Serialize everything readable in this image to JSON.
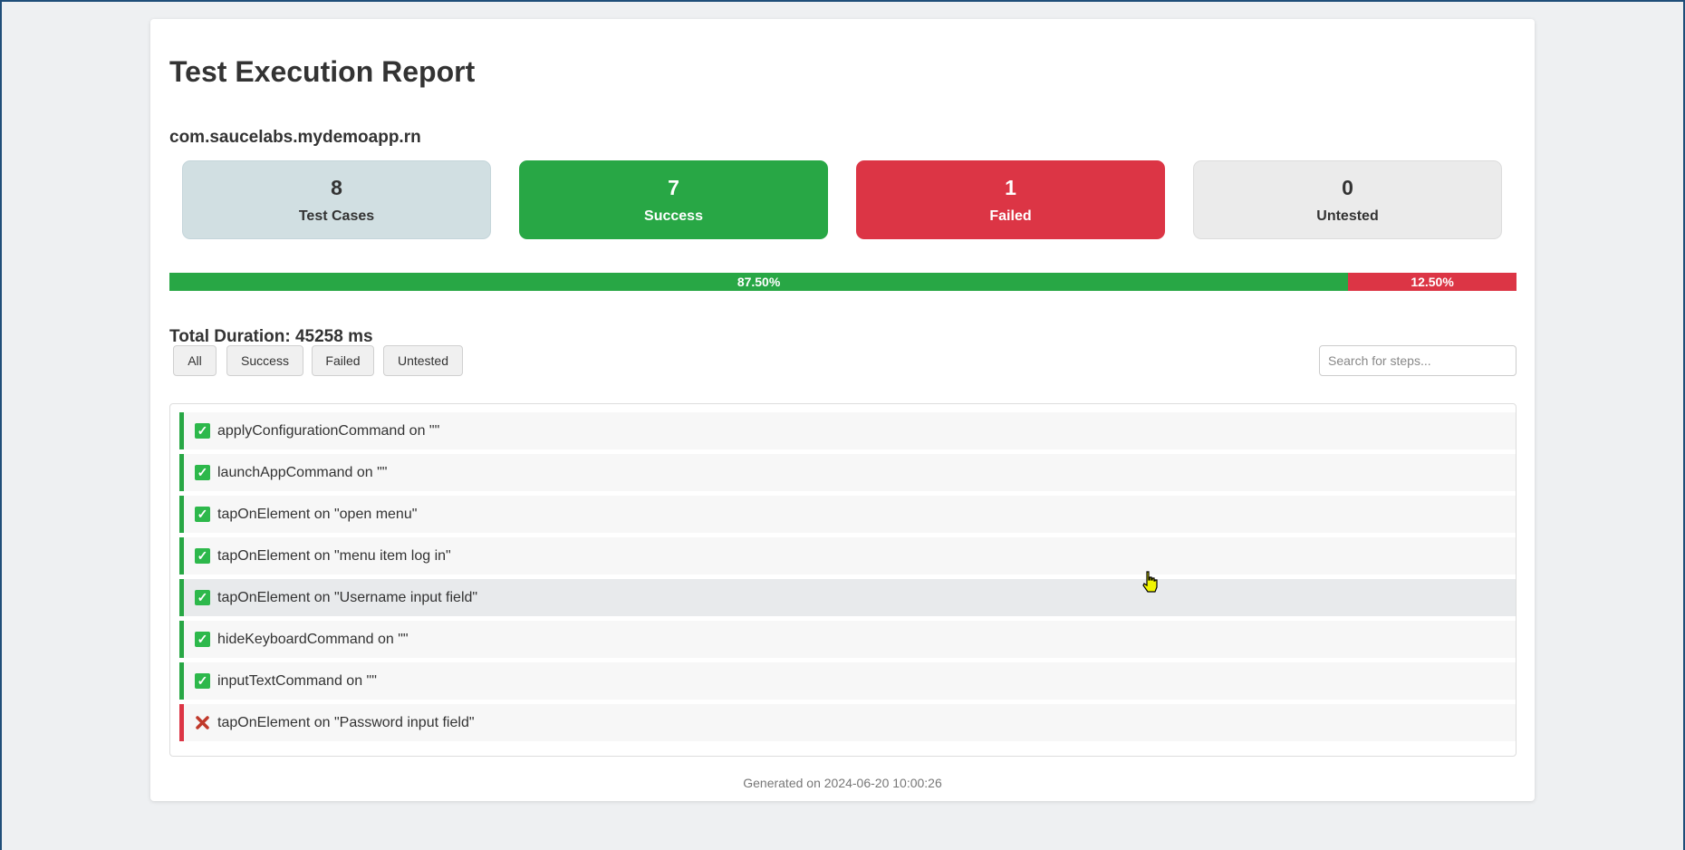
{
  "report": {
    "title": "Test Execution Report",
    "package": "com.saucelabs.mydemoapp.rn"
  },
  "stats": {
    "total": {
      "value": "8",
      "label": "Test Cases"
    },
    "success": {
      "value": "7",
      "label": "Success"
    },
    "failed": {
      "value": "1",
      "label": "Failed"
    },
    "untested": {
      "value": "0",
      "label": "Untested"
    }
  },
  "progress": {
    "success_label": "87.50%",
    "failed_label": "12.50%",
    "success_fraction": 0.875,
    "failed_fraction": 0.125
  },
  "duration_text": "Total Duration: 45258 ms",
  "filters": [
    "All",
    "Success",
    "Failed",
    "Untested"
  ],
  "search": {
    "placeholder": "Search for steps..."
  },
  "steps": [
    {
      "text": "applyConfigurationCommand on \"\"",
      "status": "success"
    },
    {
      "text": "launchAppCommand on \"\"",
      "status": "success"
    },
    {
      "text": "tapOnElement on \"open menu\"",
      "status": "success"
    },
    {
      "text": "tapOnElement on \"menu item log in\"",
      "status": "success"
    },
    {
      "text": "tapOnElement on \"Username input field\"",
      "status": "success"
    },
    {
      "text": "hideKeyboardCommand on \"\"",
      "status": "success"
    },
    {
      "text": "inputTextCommand on \"\"",
      "status": "success"
    },
    {
      "text": "tapOnElement on \"Password input field\"",
      "status": "failed"
    }
  ],
  "footer": "Generated on 2024-06-20 10:00:26",
  "colors": {
    "success": "#28a745",
    "failed": "#dc3545",
    "total_bg": "#d1dfe2",
    "untested_bg": "#ebebeb"
  },
  "icons": {
    "success": "check-box-icon",
    "failed": "cross-icon"
  }
}
